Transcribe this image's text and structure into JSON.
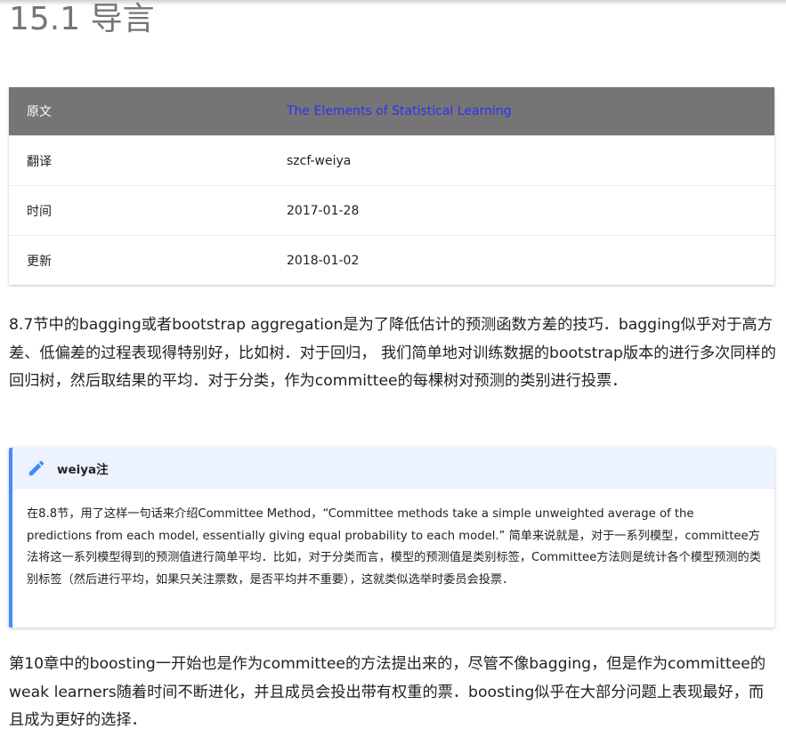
{
  "page": {
    "title": "15.1 导言"
  },
  "info_table": {
    "header": {
      "label": "原文",
      "value": "The Elements of Statistical Learning"
    },
    "rows": [
      {
        "label": "翻译",
        "value": "szcf-weiya"
      },
      {
        "label": "时间",
        "value": "2017-01-28"
      },
      {
        "label": "更新",
        "value": "2018-01-02"
      }
    ]
  },
  "paragraph_1": "8.7节中的bagging或者bootstrap aggregation是为了降低估计的预测函数方差的技巧．bagging似乎对于高方差、低偏差的过程表现得特别好，比如树．对于回归， 我们简单地对训练数据的bootstrap版本的进行多次同样的回归树，然后取结果的平均．对于分类，作为committee的每棵树对预测的类别进行投票．",
  "note": {
    "icon": "pencil-icon",
    "title": "weiya注",
    "body": "在8.8节，用了这样一句话来介绍Committee Method，“Committee methods take a simple unweighted average of the predictions from each model, essentially giving equal probability to each model.” 简单来说就是，对于一系列模型，committee方法将这一系列模型得到的预测值进行简单平均．比如，对于分类而言，模型的预测值是类别标签，Committee方法则是统计各个模型预测的类别标签（然后进行平均，如果只关注票数，是否平均并不重要），这就类似选举时委员会投票．",
    "accent_color": "#448aff",
    "header_bg": "#ecf3ff"
  },
  "paragraph_2": "第10章中的boosting一开始也是作为committee的方法提出来的，尽管不像bagging，但是作为committee的weak learners随着时间不断进化，并且成员会投出带有权重的票．boosting似乎在大部分问题上表现最好，而且成为更好的选择．",
  "colors": {
    "table_header_bg": "#757575",
    "link": "#2f2ff5",
    "title": "#757575"
  }
}
